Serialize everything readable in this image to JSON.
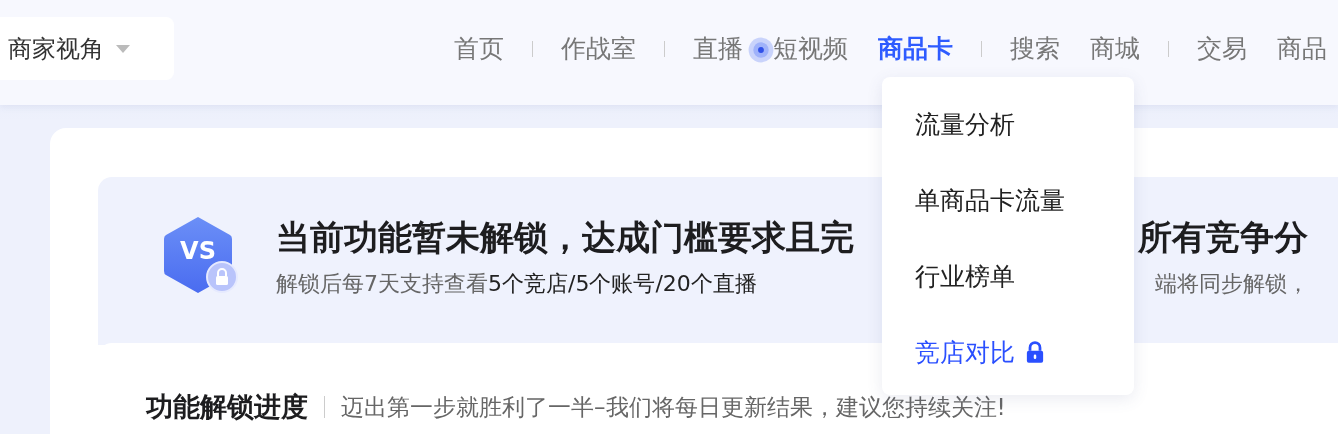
{
  "perspective": {
    "label": "商家视角"
  },
  "nav": [
    {
      "label": "首页",
      "selected": false,
      "divider_after": true
    },
    {
      "label": "作战室",
      "selected": false,
      "divider_after": true
    },
    {
      "label": "直播",
      "selected": false,
      "divider_after": false
    },
    {
      "label": "短视频",
      "selected": false,
      "divider_after": false
    },
    {
      "label": "商品卡",
      "selected": true,
      "divider_after": true
    },
    {
      "label": "搜索",
      "selected": false,
      "divider_after": false
    },
    {
      "label": "商城",
      "selected": false,
      "divider_after": true
    },
    {
      "label": "交易",
      "selected": false,
      "divider_after": false
    },
    {
      "label": "商品",
      "selected": false,
      "divider_after": false
    }
  ],
  "dropdown": [
    {
      "label": "流量分析",
      "locked": false
    },
    {
      "label": "单商品卡流量",
      "locked": false
    },
    {
      "label": "行业榜单",
      "locked": false
    },
    {
      "label": "竞店对比",
      "locked": true
    }
  ],
  "banner": {
    "badge": "VS",
    "title_parts": [
      "当前功能暂未解锁，达成门槛要求且完",
      "所有竞争分"
    ],
    "subtitle_parts": [
      "解锁后每7天支持查看**5个竞店/5个账号/20个直播**",
      "端将同步解锁，"
    ]
  },
  "progress": {
    "title": "功能解锁进度",
    "note": "迈出第一步就胜利了一半–我们将每日更新结果，建议您持续关注!"
  }
}
